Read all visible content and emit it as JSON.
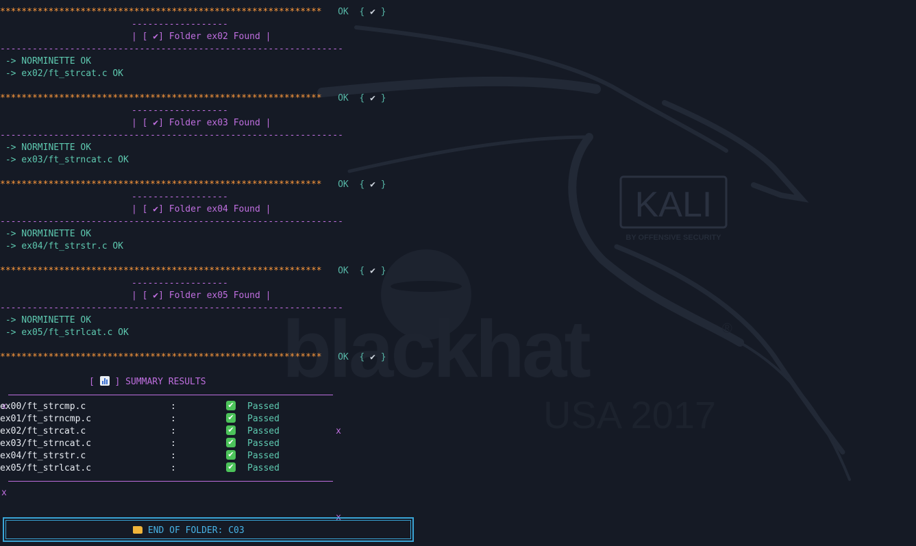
{
  "checks": [
    {
      "stars": "************************************************************",
      "status": "OK",
      "mark": "✔",
      "dashes": "------------------",
      "folder_label": "| [ ✔] Folder ex02 Found |",
      "divider": "----------------------------------------------------------------",
      "norm": " -> NORMINETTE OK",
      "result": " -> ex02/ft_strcat.c OK"
    },
    {
      "stars": "************************************************************",
      "status": "OK",
      "mark": "✔",
      "dashes": "------------------",
      "folder_label": "| [ ✔] Folder ex03 Found |",
      "divider": "----------------------------------------------------------------",
      "norm": " -> NORMINETTE OK",
      "result": " -> ex03/ft_strncat.c OK"
    },
    {
      "stars": "************************************************************",
      "status": "OK",
      "mark": "✔",
      "dashes": "------------------",
      "folder_label": "| [ ✔] Folder ex04 Found |",
      "divider": "----------------------------------------------------------------",
      "norm": " -> NORMINETTE OK",
      "result": " -> ex04/ft_strstr.c OK"
    },
    {
      "stars": "************************************************************",
      "status": "OK",
      "mark": "✔",
      "dashes": "------------------",
      "folder_label": "| [ ✔] Folder ex05 Found |",
      "divider": "----------------------------------------------------------------",
      "norm": " -> NORMINETTE OK",
      "result": " -> ex05/ft_strlcat.c OK"
    }
  ],
  "final_stars": "************************************************************",
  "final_status": "OK",
  "final_mark": "✔",
  "summary": {
    "title": "SUMMARY RESULTS",
    "icon": "bar-chart-icon",
    "rule_end": "x",
    "rows": [
      {
        "file": "ex00/ft_strcmp.c",
        "sep": ":",
        "status": "Passed"
      },
      {
        "file": "ex01/ft_strncmp.c",
        "sep": ":",
        "status": "Passed"
      },
      {
        "file": "ex02/ft_strcat.c",
        "sep": ":",
        "status": "Passed"
      },
      {
        "file": "ex03/ft_strncat.c",
        "sep": ":",
        "status": "Passed"
      },
      {
        "file": "ex04/ft_strstr.c",
        "sep": ":",
        "status": "Passed"
      },
      {
        "file": "ex05/ft_strlcat.c",
        "sep": ":",
        "status": "Passed"
      }
    ]
  },
  "end_box": {
    "icon": "open-folder-icon",
    "label": "END OF FOLDER: C03"
  },
  "wallpaper": {
    "kali_text": "KALI",
    "kali_sub": "BY OFFENSIVE SECURITY",
    "blackhat_text": "blackhat",
    "registered": "®",
    "event": "USA 2017"
  },
  "colors": {
    "background": "#151a25",
    "stars": "#ff9a3c",
    "ok": "#56b6a6",
    "purple": "#c06fe0",
    "cyan": "#5ec9b0",
    "box_border": "#3aa6d8"
  }
}
